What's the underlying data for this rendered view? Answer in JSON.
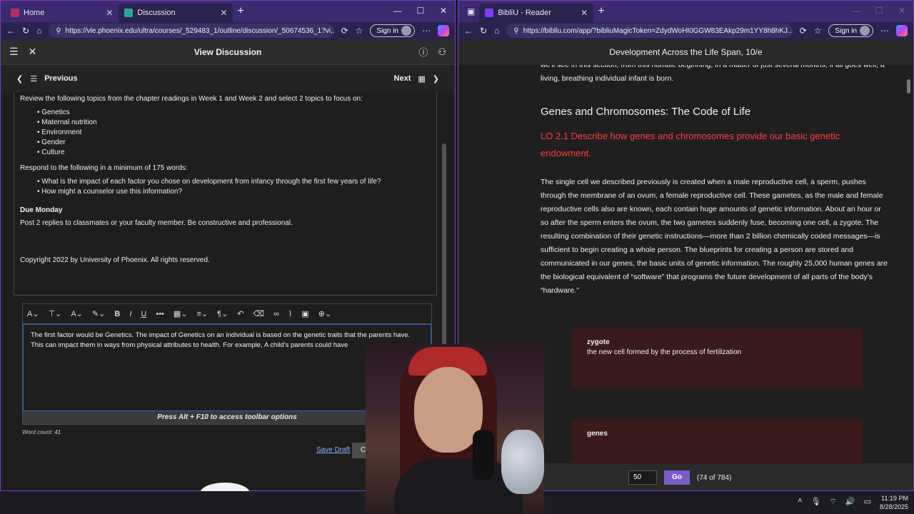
{
  "left_browser": {
    "tabs": [
      {
        "label": "Home",
        "active": false
      },
      {
        "label": "Discussion",
        "active": true
      }
    ],
    "url": "https://vle.phoenix.edu/ultra/courses/_529483_1/outline/discussion/_50674536_1?vi...",
    "signin": "Sign in"
  },
  "right_browser": {
    "tabs": [
      {
        "label": "BibliU - Reader",
        "active": true
      }
    ],
    "url": "https://bibliu.com/app/?bibliuMagicToken=ZdydWoHI0GGW83EAkp29m1YY8h8hKJ...",
    "signin": "Sign in"
  },
  "discussion": {
    "header_title": "View Discussion",
    "prev_label": "Previous",
    "next_label": "Next",
    "intro": "Review the following topics from the chapter readings in Week 1 and Week 2 and select 2 topics to focus on:",
    "topics": [
      "Genetics",
      "Maternal nutrition",
      "Environment",
      "Gender",
      "Culture"
    ],
    "respond_intro": "Respond to the following in a minimum of 175 words:",
    "questions": [
      "What is the impact of each factor you chose on development from infancy through the first few years of life?",
      "How might a counselor use this information?"
    ],
    "due_heading": "Due Monday",
    "due_text": "Post 2 replies to classmates or your faculty member. Be constructive and professional.",
    "copyright": "Copyright 2022 by University of Phoenix. All rights reserved.",
    "editor_text": "The first factor would be Genetics. The impact of Genetics on an individual is based on the genetic traits that the parents have. This can impact them in ways from physical attributes to health.  For example, A child's parents could have",
    "toolbar_hint": "Press Alt + F10 to access toolbar options",
    "word_count": "Word count: 41",
    "save_draft": "Save Draft",
    "submit_partial": "C"
  },
  "reader": {
    "book_title": "Development Across the Life Span, 10/e",
    "top_partial": "we'll see in this section, from this humble beginning, in a matter of just several months, if all goes well, a living, breathing individual infant is born.",
    "section_heading": "Genes and Chromosomes: The Code of Life",
    "lo_text": "LO 2.1   Describe how genes and chromosomes provide our basic genetic endowment.",
    "paragraph": "The single cell we described previously is created when a male reproductive cell, a sperm, pushes through the membrane of an ovum, a female reproductive cell. These gametes, as the male and female reproductive cells also are known, each contain huge amounts of genetic information. About an hour or so after the sperm enters the ovum, the two gametes suddenly fuse, becoming one cell, a zygote. The resulting combination of their genetic instructions—more than 2 billion chemically coded messages—is sufficient to begin creating a whole person. The blueprints for creating a person are stored and communicated in our genes, the basic units of genetic information. The roughly 25,000 human genes are the biological equivalent of “software” that programs the future development of all parts of the body’s “hardware.”",
    "term1": {
      "term": "zygote",
      "definition": "the new cell formed by the process of fertilization"
    },
    "term2": {
      "term": "genes"
    },
    "page_input": "50",
    "go_label": "Go",
    "page_count": "(74 of 784)"
  },
  "taskbar": {
    "time": "11:19 PM",
    "date": "8/28/2025"
  },
  "colors": {
    "frame": "#7a3cc8",
    "lo_red": "#ff3d3d",
    "go_button": "#7a5bc8",
    "term_box": "#3a1a1a"
  }
}
